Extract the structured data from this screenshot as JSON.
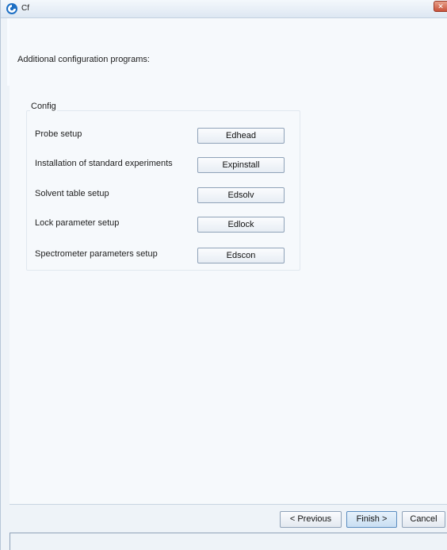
{
  "window": {
    "title": "Cf"
  },
  "main": {
    "header": "Additional configuration programs:",
    "config_group": {
      "title": "Config",
      "rows": [
        {
          "label": "Probe setup",
          "button": "Edhead"
        },
        {
          "label": "Installation of standard experiments",
          "button": "Expinstall"
        },
        {
          "label": "Solvent table setup",
          "button": "Edsolv"
        },
        {
          "label": "Lock parameter setup",
          "button": "Edlock"
        },
        {
          "label": "Spectrometer parameters setup",
          "button": "Edscon"
        }
      ]
    }
  },
  "footer": {
    "previous_label": "< Previous",
    "finish_label": "Finish >",
    "cancel_label": "Cancel"
  },
  "colors": {
    "accent": "#5b8dc0",
    "close": "#c8523a"
  }
}
